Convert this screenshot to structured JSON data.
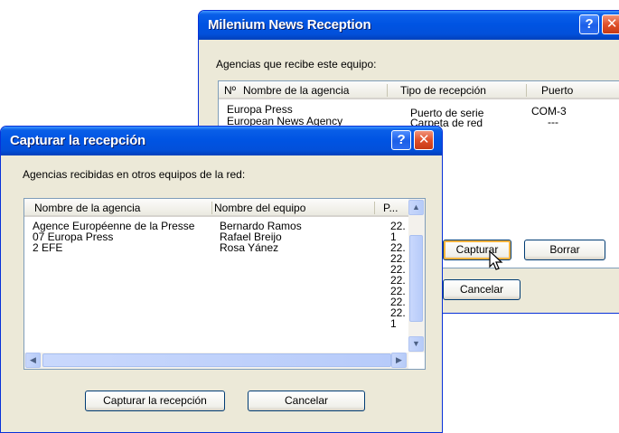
{
  "back_dialog": {
    "title": "Milenium News Reception",
    "help_glyph": "?",
    "close_glyph": "✕",
    "list_label": "Agencias que recibe este equipo:",
    "columns": [
      "Nº",
      "Nombre de la agencia",
      "Tipo de recepción",
      "Puerto"
    ],
    "rows": [
      {
        "name": "Europa Press",
        "tipo": "Puerto de serie",
        "puerto": "COM-3"
      },
      {
        "name": "European News Agency",
        "tipo": "Carpeta de red",
        "puerto": "---"
      }
    ],
    "buttons": {
      "capture": "Capturar",
      "delete": "Borrar",
      "cancel": "Cancelar"
    }
  },
  "front_dialog": {
    "title": "Capturar la recepción",
    "help_glyph": "?",
    "close_glyph": "✕",
    "list_label": "Agencias recibidas  en otros equipos de la red:",
    "columns": [
      "Nombre de la agencia",
      "Nombre del equipo",
      "P..."
    ],
    "rows": [
      {
        "name": "Agence Européenne de la Presse",
        "equipo": "Bernardo Ramos",
        "p": "22."
      },
      {
        "name": "07 Europa Press",
        "equipo": "Rafael Breijo",
        "p": "1"
      },
      {
        "name": "2 EFE",
        "equipo": "Rosa Yánez",
        "p": "22."
      },
      {
        "name": "",
        "equipo": "",
        "p": "22."
      },
      {
        "name": "",
        "equipo": "",
        "p": "22."
      },
      {
        "name": "",
        "equipo": "",
        "p": "22."
      },
      {
        "name": "",
        "equipo": "",
        "p": "22."
      },
      {
        "name": "",
        "equipo": "",
        "p": "22."
      },
      {
        "name": "",
        "equipo": "",
        "p": "22."
      },
      {
        "name": "",
        "equipo": "",
        "p": "1"
      }
    ],
    "buttons": {
      "capture": "Capturar la recepción",
      "cancel": "Cancelar"
    }
  },
  "icons": {
    "scroll_up": "▲",
    "scroll_down": "▼",
    "scroll_left": "◀",
    "scroll_right": "▶"
  },
  "colors": {
    "titlebar": "#0054e3",
    "window_bg": "#ece9d8",
    "close_button": "#e0502a"
  }
}
